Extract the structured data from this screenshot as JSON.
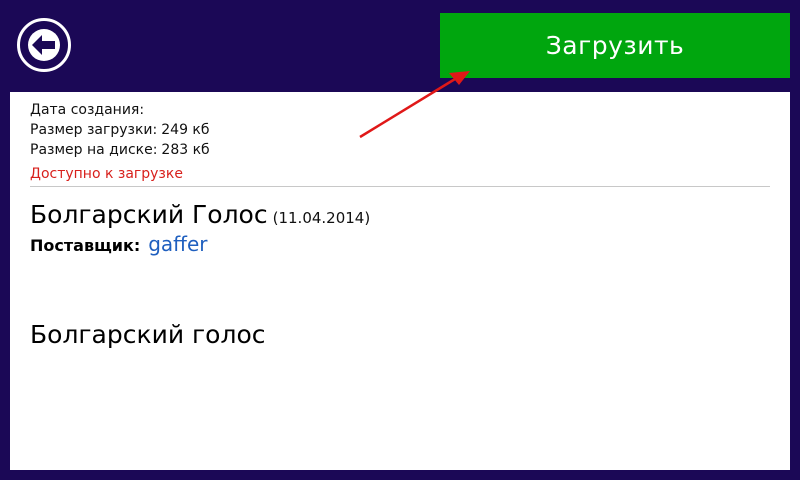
{
  "header": {
    "back_icon": "arrow-left-icon",
    "download_label": "Загрузить"
  },
  "info": {
    "created_label": "Дата создания:",
    "created_value": "",
    "download_size_label": "Размер загрузки:",
    "download_size_value": "249 кб",
    "disk_size_label": "Размер на диске:",
    "disk_size_value": "283 кб",
    "availability": "Доступно к загрузке"
  },
  "item": {
    "title": "Болгарский Голос",
    "date": "(11.04.2014)",
    "provider_label": "Поставщик:",
    "provider_name": "gaffer",
    "description": "Болгарский голос"
  },
  "colors": {
    "background": "#1b0856",
    "download_button": "#00a60e",
    "availability_text": "#d8201c",
    "provider_link": "#1f5fbf",
    "annotation_arrow": "#e01818"
  }
}
